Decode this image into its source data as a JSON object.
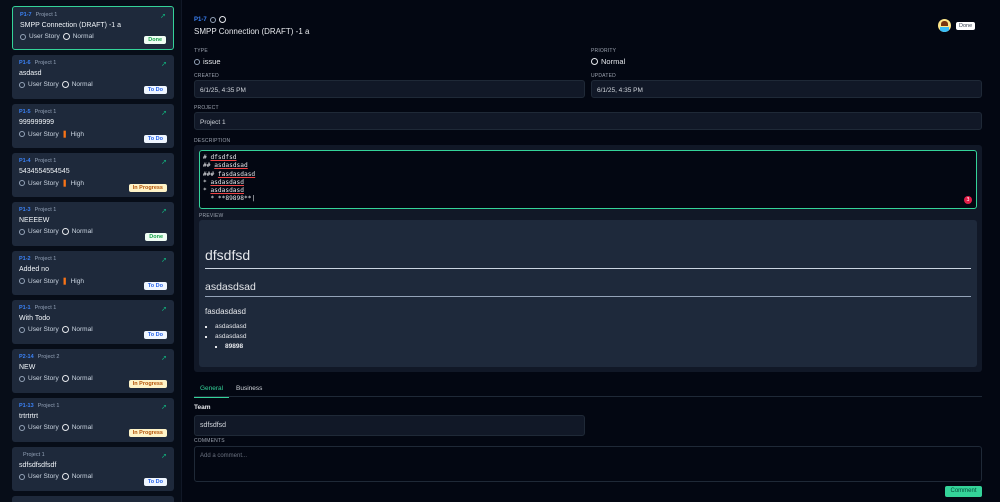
{
  "sidebar": {
    "cards": [
      {
        "key": "P1-7",
        "project": "Project 1",
        "title": "SMPP Connection (DRAFT) -1 a",
        "type": "User Story",
        "priority": "Normal",
        "status": "Done"
      },
      {
        "key": "P1-6",
        "project": "Project 1",
        "title": "asdasd",
        "type": "User Story",
        "priority": "Normal",
        "status": "To Do"
      },
      {
        "key": "P1-5",
        "project": "Project 1",
        "title": "999999999",
        "type": "User Story",
        "priority": "High",
        "status": "To Do"
      },
      {
        "key": "P1-4",
        "project": "Project 1",
        "title": "5434554554545",
        "type": "User Story",
        "priority": "High",
        "status": "In Progress"
      },
      {
        "key": "P1-3",
        "project": "Project 1",
        "title": "NEEEEW",
        "type": "User Story",
        "priority": "Normal",
        "status": "Done"
      },
      {
        "key": "P1-2",
        "project": "Project 1",
        "title": "Added no",
        "type": "User Story",
        "priority": "High",
        "status": "To Do"
      },
      {
        "key": "P1-1",
        "project": "Project 1",
        "title": "With Todo",
        "type": "User Story",
        "priority": "Normal",
        "status": "To Do"
      },
      {
        "key": "P2-14",
        "project": "Project 2",
        "title": "NEW",
        "type": "User Story",
        "priority": "Normal",
        "status": "In Progress"
      },
      {
        "key": "P1-13",
        "project": "Project 1",
        "title": "trtrtrtrt",
        "type": "User Story",
        "priority": "Normal",
        "status": "In Progress"
      },
      {
        "key": "",
        "project": "Project 1",
        "title": "sdfsdfsdfsdf",
        "type": "User Story",
        "priority": "Normal",
        "status": "To Do"
      }
    ]
  },
  "detail": {
    "key": "P1-7",
    "title": "SMPP Connection (DRAFT) -1 a",
    "status": "Done",
    "type_label": "TYPE",
    "type": "issue",
    "priority_label": "PRIORITY",
    "priority": "Normal",
    "created_label": "CREATED",
    "created": "6/1/25, 4:35 PM",
    "updated_label": "UPDATED",
    "updated": "6/1/25, 4:35 PM",
    "project_label": "PROJECT",
    "project": "Project 1",
    "description_label": "DESCRIPTION",
    "source": {
      "l1p": "# ",
      "l1": "dfsdfsd",
      "l2p": "## ",
      "l2": "asdasdsad",
      "l3p": "### ",
      "l3": "fasdasdasd",
      "l4p": "* ",
      "l4": "asdasdasd",
      "l5p": "* ",
      "l5": "asdasdasd",
      "l6": "  * **89898**"
    },
    "error_count": "3",
    "preview_label": "PREVIEW",
    "preview": {
      "h1": "dfsdfsd",
      "h2": "asdasdsad",
      "h3": "fasdasdasd",
      "items": [
        "asdasdasd",
        "asdasdasd"
      ],
      "sub": "89898"
    },
    "tabs": [
      "General",
      "Business"
    ],
    "team_label": "Team",
    "team": "sdfsdfsd",
    "comments_label": "COMMENTS",
    "comment_placeholder": "Add a comment...",
    "comment_button": "Comment"
  }
}
